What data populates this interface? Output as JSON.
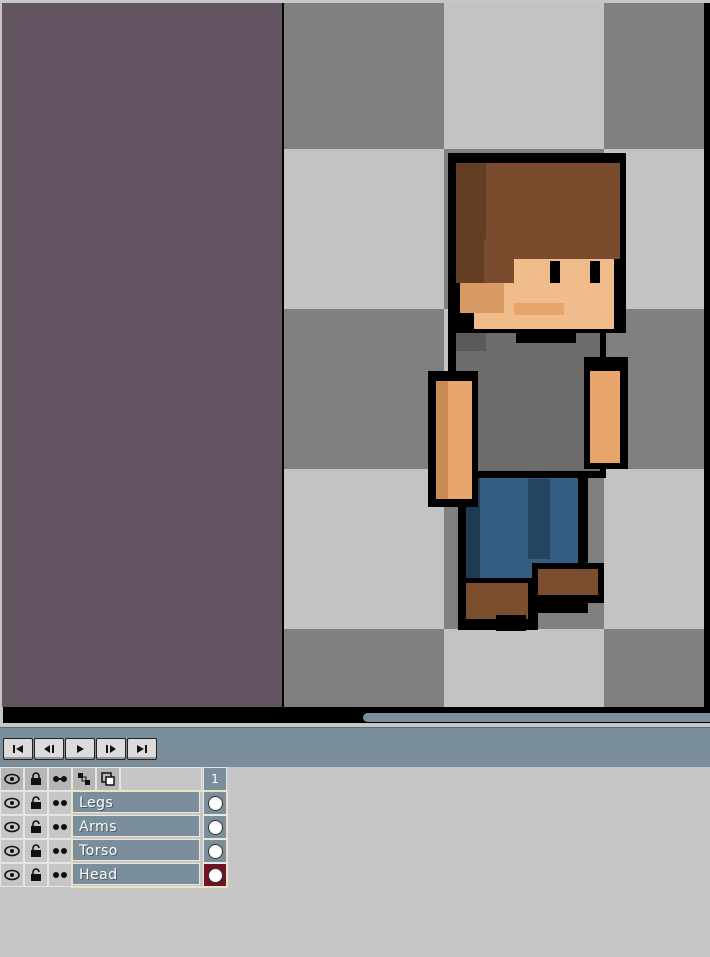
{
  "timeline": {
    "buttons": [
      {
        "name": "first-frame-button",
        "icon": "skip-first-icon"
      },
      {
        "name": "previous-frame-button",
        "icon": "step-back-icon"
      },
      {
        "name": "play-button",
        "icon": "play-icon"
      },
      {
        "name": "next-frame-button",
        "icon": "step-forward-icon"
      },
      {
        "name": "last-frame-button",
        "icon": "skip-last-icon"
      }
    ]
  },
  "layers": {
    "header_icons": [
      "eye-icon",
      "lock-icon",
      "continuous-icon",
      "link-icon",
      "new-layer-icon"
    ],
    "frame_number": "1",
    "items": [
      {
        "label": "Legs",
        "active": false
      },
      {
        "label": "Arms",
        "active": false
      },
      {
        "label": "Torso",
        "active": false
      },
      {
        "label": "Head",
        "active": true
      }
    ]
  },
  "colors": {
    "background_area": "#625460",
    "checker_light": "#c3c3c3",
    "checker_dark": "#808080",
    "panel_accent": "#7b8e9c",
    "active_cel": "#6e1424"
  }
}
